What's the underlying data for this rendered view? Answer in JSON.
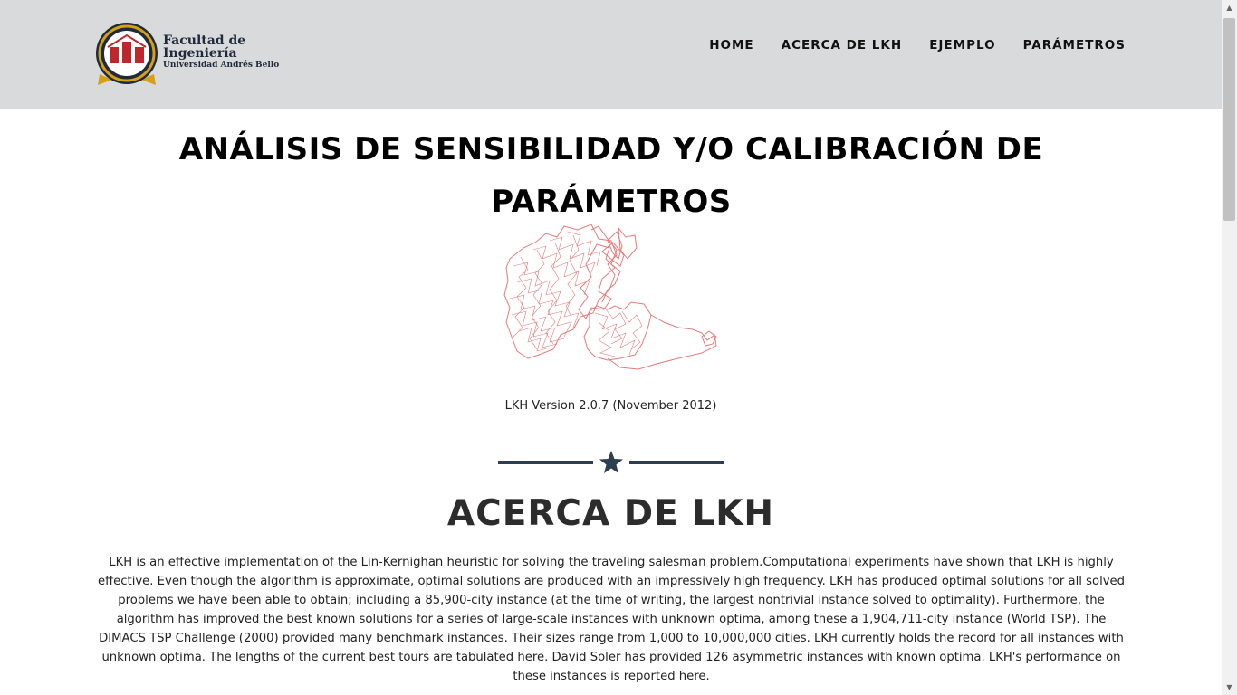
{
  "header": {
    "logo": {
      "line1": "Facultad de",
      "line2": "Ingeniería",
      "line3": "Universidad Andrés Bello"
    },
    "nav": [
      "HOME",
      "ACERCA DE LKH",
      "EJEMPLO",
      "PARÁMETROS"
    ]
  },
  "hero": {
    "title": "ANÁLISIS DE SENSIBILIDAD Y/O CALIBRACIÓN DE PARÁMETROS",
    "image_name": "tsp-tour-map",
    "caption": "LKH Version 2.0.7 (November 2012)"
  },
  "divider_icon": "star-icon",
  "about": {
    "title": "ACERCA DE LKH",
    "text": "LKH is an effective implementation of the Lin-Kernighan heuristic for solving the traveling salesman problem.Computational experiments have shown that LKH is highly effective. Even though the algorithm is approximate, optimal solutions are produced with an impressively high frequency. LKH has produced optimal solutions for all solved problems we have been able to obtain; including a 85,900-city instance (at the time of writing, the largest nontrivial instance solved to optimality). Furthermore, the algorithm has improved the best known solutions for a series of large-scale instances with unknown optima, among these a 1,904,711-city instance (World TSP). The DIMACS TSP Challenge (2000) provided many benchmark instances. Their sizes range from 1,000 to 10,000,000 cities. LKH currently holds the record for all instances with unknown optima. The lengths of the current best tours are tabulated here. David Soler has provided 126 asymmetric instances with known optima. LKH's performance on these instances is reported here."
  },
  "colors": {
    "navbar_bg": "#d9dadc",
    "accent_dark": "#2c3e50",
    "logo_red": "#c0272d",
    "logo_gold": "#d4a017",
    "map_red": "#e87a7a"
  }
}
